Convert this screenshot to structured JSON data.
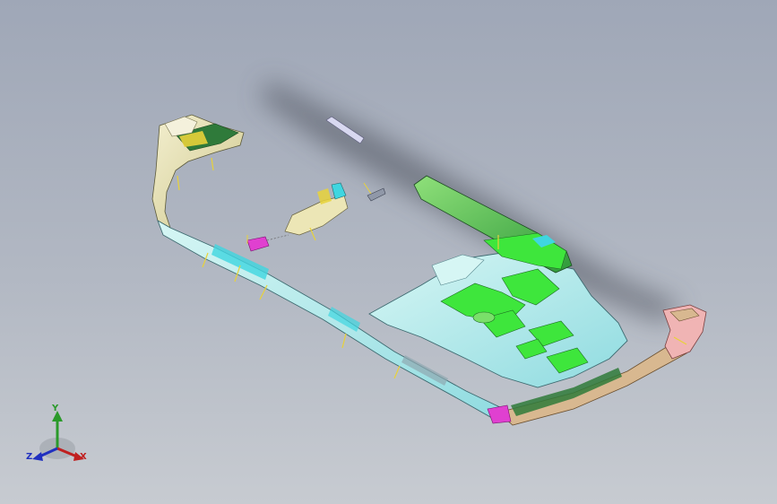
{
  "viewport": {
    "background_top": "#9fa7b7",
    "background_bottom": "#c7cbd1"
  },
  "model": {
    "colors": {
      "shadow": "#4a4e58",
      "frame_light": "#bfeff0",
      "frame_cyan": "#3fd6e0",
      "panel_green": "#3ee63c",
      "dark_green": "#2f7a3a",
      "cream": "#ece6b6",
      "yellow": "#e8d23a",
      "magenta": "#e040d0",
      "pink": "#f0b4b4",
      "tan": "#d8b890"
    }
  },
  "triad": {
    "y_label": "Y",
    "x_label": "X",
    "z_label": "Z",
    "y_color": "#2a9a2a",
    "x_color": "#c02020",
    "z_color": "#2030c0"
  }
}
